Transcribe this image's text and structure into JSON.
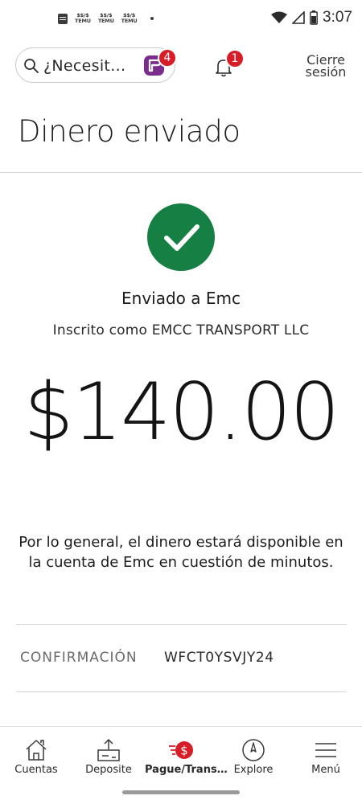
{
  "status_bar": {
    "time": "3:07",
    "notification_labels": [
      "TEMU",
      "TEMU",
      "TEMU"
    ]
  },
  "header": {
    "search_placeholder": "¿Necesit…",
    "fargo_badge": "4",
    "bell_badge": "1",
    "signoff_line1": "Cierre",
    "signoff_line2": "sesión"
  },
  "page": {
    "title": "Dinero enviado"
  },
  "confirmation": {
    "sent_to": "Enviado a Emc",
    "enrolled_as": "Inscrito como EMCC TRANSPORT LLC",
    "amount": "$140.00",
    "availability": "Por lo general, el dinero estará disponible en la cuenta de Emc en cuestión de minutos.",
    "label": "CONFIRMACIÓN",
    "code": "WFCT0YSVJY24"
  },
  "bottom_nav": {
    "items": [
      {
        "label": "Cuentas",
        "icon": "home-icon"
      },
      {
        "label": "Deposite",
        "icon": "deposit-icon"
      },
      {
        "label": "Pague/Trans…",
        "icon": "pay-transfer-icon"
      },
      {
        "label": "Explore",
        "icon": "compass-icon"
      },
      {
        "label": "Menú",
        "icon": "menu-icon"
      }
    ]
  },
  "colors": {
    "success_green": "#168044",
    "brand_red": "#d71e28",
    "fargo_purple": "#7b2d8e"
  }
}
